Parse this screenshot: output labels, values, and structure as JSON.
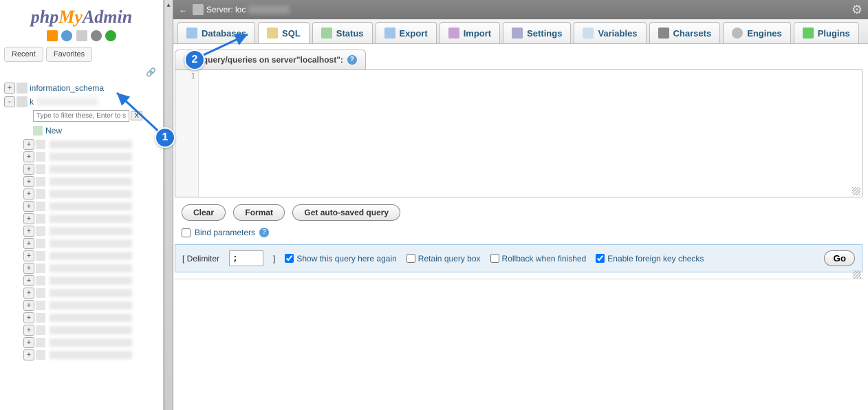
{
  "logo": {
    "part1": "php",
    "part2": "My",
    "part3": "Admin"
  },
  "sidebar_tabs": {
    "recent": "Recent",
    "favorites": "Favorites"
  },
  "tree": {
    "db1": "information_schema",
    "db2_prefix": "k",
    "filter_placeholder": "Type to filter these, Enter to search",
    "filter_clear": "X",
    "new_label": "New"
  },
  "topbar": {
    "server_label": "Server: loc"
  },
  "tabs": [
    {
      "label": "Databases",
      "icon": "db"
    },
    {
      "label": "SQL",
      "icon": "sql"
    },
    {
      "label": "Status",
      "icon": "status"
    },
    {
      "label": "Export",
      "icon": "export"
    },
    {
      "label": "Import",
      "icon": "import"
    },
    {
      "label": "Settings",
      "icon": "settings"
    },
    {
      "label": "Variables",
      "icon": "vars"
    },
    {
      "label": "Charsets",
      "icon": "charsets"
    },
    {
      "label": "Engines",
      "icon": "engines"
    },
    {
      "label": "Plugins",
      "icon": "plugins"
    }
  ],
  "panel": {
    "title_prefix": "SQL query/queries on server ",
    "title_quoted": "\"localhost\"",
    "title_suffix": ": ",
    "gutter_line": "1"
  },
  "buttons": {
    "clear": "Clear",
    "format": "Format",
    "get_autosaved": "Get auto-saved query"
  },
  "bind": {
    "label": "Bind parameters"
  },
  "footer": {
    "delimiter_label": "[ Delimiter",
    "delimiter_value": ";",
    "delimiter_close": "]",
    "show_again": "Show this query here again",
    "retain": "Retain query box",
    "rollback": "Rollback when finished",
    "fk": "Enable foreign key checks",
    "go": "Go",
    "show_again_checked": true,
    "retain_checked": false,
    "rollback_checked": false,
    "fk_checked": true
  },
  "callouts": {
    "one": "1",
    "two": "2"
  }
}
